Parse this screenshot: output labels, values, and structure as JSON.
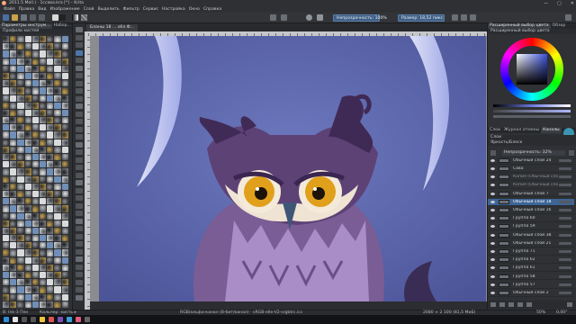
{
  "window": {
    "title": "2011.5 Moll.) · 1ссава.kra [*] – Krita",
    "controls": [
      "—",
      "▢",
      "✕"
    ]
  },
  "menu": [
    "Файл",
    "Правка",
    "Вид",
    "Изображение",
    "Слой",
    "Выделить",
    "Фильтр",
    "Сервис",
    "Настройка",
    "Окно",
    "Справка"
  ],
  "toolbar": {
    "opacity_label": "Непрозрачность: 100%",
    "size_label": "Размер: 18,52 пикс"
  },
  "left_panel": {
    "tabs": [
      "Параметры инструм...",
      "Набор..."
    ],
    "header": "Профили кистей"
  },
  "document": {
    "tab_label": "Бланш 18 ... обл.Ф..."
  },
  "statusbar": {
    "left": "В: Ink-3 Пен",
    "left2": "Кальпер: кисть ▸",
    "center": "RGB/альфа-канал (8-бит/канал) · sRGB-elle-V2-srgbtrc.icc",
    "right": "2080 × 2 100 (81,5 МиБ)",
    "zoom": "50%",
    "angle": "0,00°"
  },
  "right_panel": {
    "color_selector_tabs": [
      "Расширенный выбор цвета",
      "Обзор"
    ],
    "color_selector_title": "Расширенный выбор цвета",
    "mid_tabs": [
      "Слои",
      "Журнал отмены",
      "Каналы"
    ],
    "layers_title": "Слои",
    "blend_mode": "Яркость/Блеск",
    "opacity": "Непрозрачность: 32%",
    "accent": "#3d6596",
    "layers": [
      {
        "name": "Обычный слой 24",
        "state": "normal"
      },
      {
        "name": "Сова",
        "state": "normal"
      },
      {
        "name": "Копия (Обычный слой 7) (2)",
        "state": "dim"
      },
      {
        "name": "Копия (Обычный слой 7)",
        "state": "dim"
      },
      {
        "name": "Обычный слой 7",
        "state": "normal"
      },
      {
        "name": "Обычный слой 18",
        "state": "selected"
      },
      {
        "name": "Обычный слой 16",
        "state": "normal"
      },
      {
        "name": "Группа 60",
        "state": "normal"
      },
      {
        "name": "Группа 59",
        "state": "normal"
      },
      {
        "name": "Обычный слой 38",
        "state": "normal"
      },
      {
        "name": "Обычный слой 21",
        "state": "normal"
      },
      {
        "name": "Группа 71",
        "state": "normal"
      },
      {
        "name": "Группа 62",
        "state": "normal"
      },
      {
        "name": "Группа 61",
        "state": "normal"
      },
      {
        "name": "Группа 58",
        "state": "normal"
      },
      {
        "name": "Группа 57",
        "state": "normal"
      },
      {
        "name": "Обычный слой 2",
        "state": "normal"
      }
    ]
  },
  "colors": {
    "canvas_bg": "#5a65a8",
    "owl_body": "#7a5d94",
    "owl_eye": "#e0a01c",
    "moon": "#c7ccf7"
  }
}
